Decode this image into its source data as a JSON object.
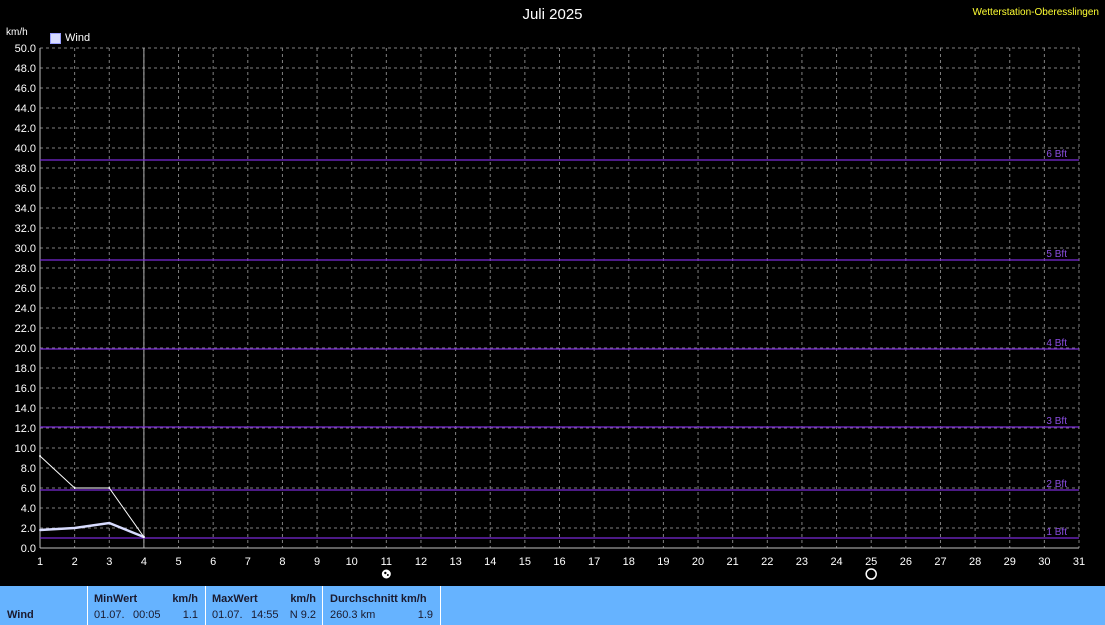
{
  "header": {
    "title": "Juli 2025",
    "station": "Wetterstation-Oberesslingen",
    "y_unit": "km/h",
    "legend_label": "Wind"
  },
  "chart_data": {
    "type": "line",
    "title": "Juli 2025",
    "ylabel": "km/h",
    "xlabel": "",
    "xlim": [
      1,
      31
    ],
    "ylim": [
      0,
      50
    ],
    "x_ticks": [
      1,
      2,
      3,
      4,
      5,
      6,
      7,
      8,
      9,
      10,
      11,
      12,
      13,
      14,
      15,
      16,
      17,
      18,
      19,
      20,
      21,
      22,
      23,
      24,
      25,
      26,
      27,
      28,
      29,
      30,
      31
    ],
    "y_ticks": [
      0,
      2,
      4,
      6,
      8,
      10,
      12,
      14,
      16,
      18,
      20,
      22,
      24,
      26,
      28,
      30,
      32,
      34,
      36,
      38,
      40,
      42,
      44,
      46,
      48,
      50
    ],
    "grid": true,
    "legend_position": "top-left",
    "series": [
      {
        "name": "Wind",
        "color": "#d8dcff",
        "x": [
          1,
          2,
          3,
          4
        ],
        "y": [
          1.8,
          2.0,
          2.5,
          1.1
        ]
      },
      {
        "color": "#ffffff",
        "x": [
          1,
          2,
          3,
          4
        ],
        "y": [
          9.2,
          6.0,
          6.0,
          1.1
        ]
      }
    ],
    "reference_lines": [
      {
        "label": "1 Bft",
        "y": 1.0
      },
      {
        "label": "2 Bft",
        "y": 5.8
      },
      {
        "label": "3 Bft",
        "y": 12.1
      },
      {
        "label": "4 Bft",
        "y": 19.9
      },
      {
        "label": "5 Bft",
        "y": 28.8
      },
      {
        "label": "6 Bft",
        "y": 38.8
      }
    ],
    "current_day_marker": 4,
    "moon_markers": [
      {
        "day": 11,
        "icon": "full-moon-icon"
      },
      {
        "day": 25,
        "icon": "new-moon-icon"
      }
    ],
    "colors": {
      "grid": "#808080",
      "reference": "#7a2bd6",
      "reference_label": "#8a4de0",
      "axis_text": "#ffffff"
    }
  },
  "footer": {
    "row_label": "Wind",
    "min": {
      "header": "MinWert",
      "unit": "km/h",
      "date": "01.07.",
      "time": "00:05",
      "value": "1.1"
    },
    "max": {
      "header": "MaxWert",
      "unit": "km/h",
      "date": "01.07.",
      "time": "14:55",
      "value": "N 9.2"
    },
    "avg": {
      "header": "Durchschnitt km/h",
      "distance": "260.3 km",
      "value": "1.9"
    }
  }
}
